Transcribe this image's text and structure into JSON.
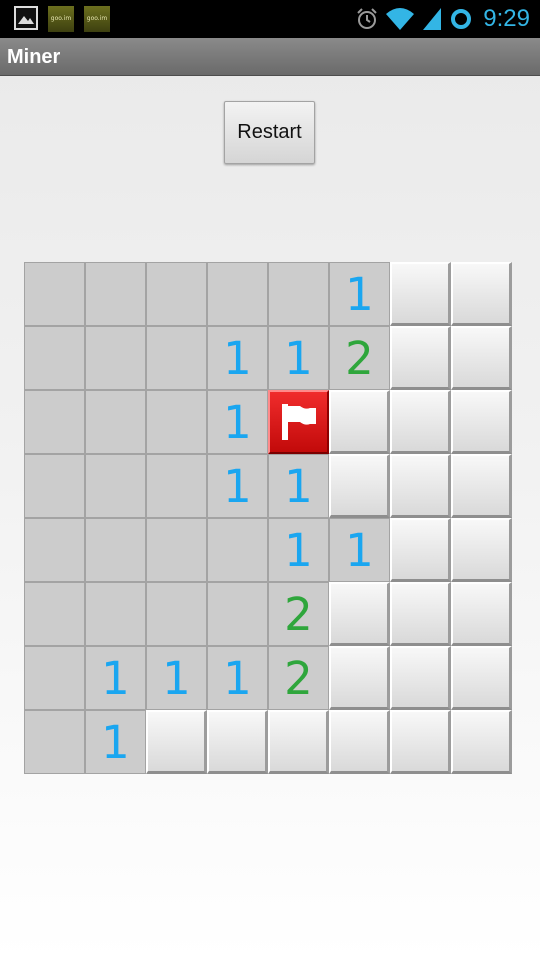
{
  "status_bar": {
    "time": "9:29",
    "notification_icons": [
      "gallery-icon",
      "app-notification-icon",
      "app-notification-icon"
    ],
    "notification_labels": [
      "",
      "goo.im",
      "goo.im"
    ],
    "status_icons": [
      "alarm-icon",
      "wifi-icon",
      "signal-icon",
      "sync-icon"
    ]
  },
  "action_bar": {
    "title": "Miner"
  },
  "controls": {
    "restart_label": "Restart"
  },
  "board": {
    "rows": 8,
    "cols": 8,
    "legend": {
      "_": "open-empty",
      "1": "open-number",
      "2": "open-number",
      "H": "hidden",
      "F": "flagged"
    },
    "grid": [
      [
        "_",
        "_",
        "_",
        "_",
        "_",
        "1",
        "H",
        "H"
      ],
      [
        "_",
        "_",
        "_",
        "1",
        "1",
        "2",
        "H",
        "H"
      ],
      [
        "_",
        "_",
        "_",
        "1",
        "F",
        "H",
        "H",
        "H"
      ],
      [
        "_",
        "_",
        "_",
        "1",
        "1",
        "H",
        "H",
        "H"
      ],
      [
        "_",
        "_",
        "_",
        "_",
        "1",
        "1",
        "H",
        "H"
      ],
      [
        "_",
        "_",
        "_",
        "_",
        "2",
        "H",
        "H",
        "H"
      ],
      [
        "_",
        "1",
        "1",
        "1",
        "2",
        "H",
        "H",
        "H"
      ],
      [
        "_",
        "1",
        "H",
        "H",
        "H",
        "H",
        "H",
        "H"
      ]
    ]
  },
  "colors": {
    "number_1": "#1aa6f0",
    "number_2": "#2fa63c",
    "flag_tile": "#e01818",
    "status_accent": "#33b5e5"
  }
}
